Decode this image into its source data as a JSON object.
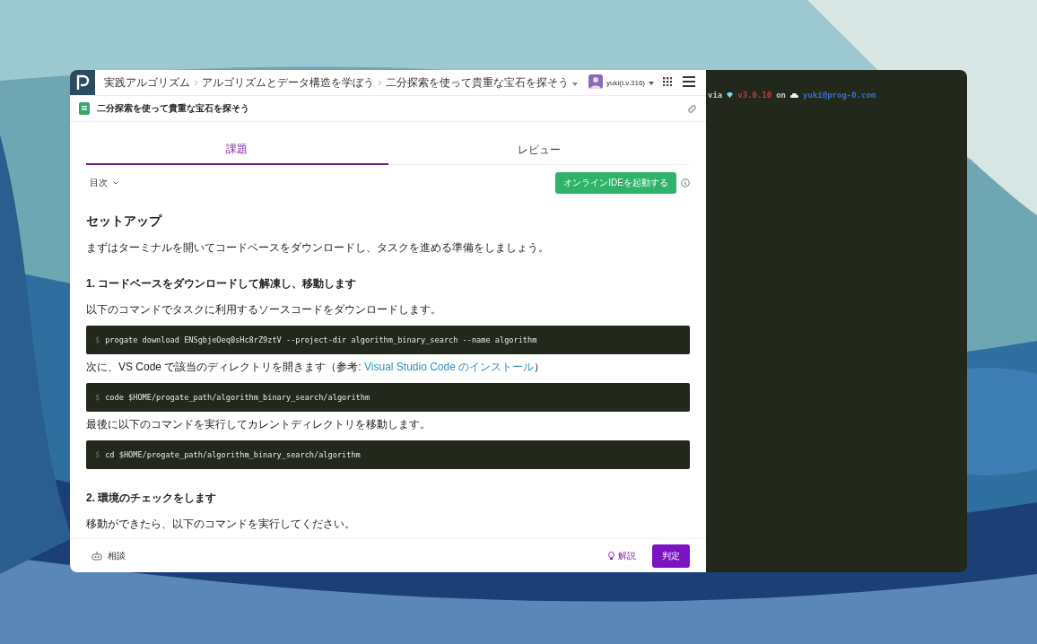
{
  "breadcrumbs": [
    {
      "label": "実践アルゴリズム"
    },
    {
      "label": "アルゴリズムとデータ構造を学ぼう"
    },
    {
      "label": "二分探索を使って貴重な宝石を探そう"
    }
  ],
  "user": {
    "name": "yuki(Lv.316)"
  },
  "lesson_title": "二分探索を使って貴重な宝石を探そう",
  "tabs": [
    {
      "label": "課題",
      "selected": true
    },
    {
      "label": "レビュー",
      "selected": false
    }
  ],
  "toc": "目次",
  "launch_button": "オンラインIDEを起動する",
  "content": [
    {
      "kind": "h1",
      "text": "セットアップ"
    },
    {
      "kind": "p",
      "text": "まずはターミナルを開いてコードベースをダウンロードし、タスクを進める準備をしましょう。"
    },
    {
      "kind": "h2",
      "text": "1. コードベースをダウンロードして解凍し、移動します"
    },
    {
      "kind": "p",
      "text": "以下のコマンドでタスクに利用するソースコードをダウンロードします。"
    },
    {
      "kind": "code",
      "prompt": "$",
      "text": "progate download ENSgbjeOeq0sHc8rZ9ztV --project-dir algorithm_binary_search --name algorithm"
    },
    {
      "kind": "link_p",
      "text": "次に、VS Code で該当のディレクトリを開きます（参考: ",
      "link": "Visual Studio Code のインストール",
      "after": "）"
    },
    {
      "kind": "code",
      "prompt": "$",
      "text": "code $HOME/progate_path/algorithm_binary_search/algorithm"
    },
    {
      "kind": "p",
      "text": "最後に以下のコマンドを実行してカレントディレクトリを移動します。"
    },
    {
      "kind": "code",
      "prompt": "$",
      "text": "cd $HOME/progate_path/algorithm_binary_search/algorithm"
    },
    {
      "kind": "h2",
      "text": "2. 環境のチェックをします"
    },
    {
      "kind": "p",
      "text": "移動ができたら、以下のコマンドを実行してください。"
    }
  ],
  "footer": {
    "consult": "相談",
    "hint": "解説",
    "judge": "判定"
  },
  "terminal": {
    "segments": [
      {
        "text": "via",
        "color": "#c8c8c8"
      },
      {
        "text": "v3.0.10",
        "color": "#c04040"
      },
      {
        "text": "on",
        "color": "#c8c8c8"
      },
      {
        "text": "yuki@prog-0.com",
        "color": "#3a6fd0"
      }
    ]
  }
}
